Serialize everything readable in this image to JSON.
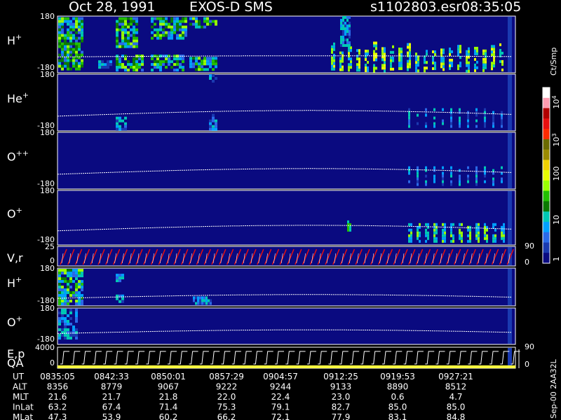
{
  "header": {
    "date": "Oct 28, 1991",
    "instrument": "EXOS-D SMS",
    "file": "s1102803.esr",
    "time": "08:35:05"
  },
  "colorbar": {
    "label": "Ct/Smp",
    "ticks": [
      {
        "text": "10",
        "exp": "4"
      },
      {
        "text": "10",
        "exp": "3"
      },
      {
        "text": "100",
        "exp": ""
      },
      {
        "text": "10",
        "exp": ""
      },
      {
        "text": "1",
        "exp": ""
      }
    ],
    "colors": [
      "#ffffff",
      "#ff9bb0",
      "#b00000",
      "#e81010",
      "#ff2a00",
      "#6b6b00",
      "#9a8a00",
      "#f0d000",
      "#e8ff00",
      "#9aff00",
      "#22c000",
      "#0a7a00",
      "#00c8b4",
      "#00a0ff",
      "#2a6ae8",
      "#1a3ab0",
      "#0a0a80"
    ]
  },
  "panels": [
    {
      "id": "h-plus",
      "label": "H",
      "sup": "+",
      "ymax": "180",
      "ymin": "-180"
    },
    {
      "id": "he-plus",
      "label": "He",
      "sup": "+",
      "ymax": "180",
      "ymin": "-180"
    },
    {
      "id": "o-plusplus",
      "label": "O",
      "sup": "++",
      "ymax": "180",
      "ymin": "-180"
    },
    {
      "id": "o-plus",
      "label": "O",
      "sup": "+",
      "ymax": "180",
      "ymin": "-180"
    },
    {
      "id": "vr",
      "label": "V,r",
      "sup": "",
      "ymax": "25",
      "ymin": "0",
      "right_top": "90",
      "right_bottom": "0"
    },
    {
      "id": "h-plus-2",
      "label": "H",
      "sup": "+",
      "ymax": "180",
      "ymin": "-180"
    },
    {
      "id": "o-plus-2",
      "label": "O",
      "sup": "+",
      "ymax": "180",
      "ymin": "-180"
    },
    {
      "id": "ep-qa",
      "label": "E,p",
      "label2": "QA",
      "sup": "",
      "ymax": "4000",
      "ymin": "0",
      "right_top": "90",
      "right_bottom": "0"
    }
  ],
  "table": {
    "rows": [
      {
        "name": "UT",
        "values": [
          "0835:05",
          "0842:33",
          "0850:01",
          "0857:29",
          "0904:57",
          "0912:25",
          "0919:53",
          "0927:21"
        ]
      },
      {
        "name": "ALT",
        "values": [
          "8356",
          "8779",
          "9067",
          "9222",
          "9244",
          "9133",
          "8890",
          "8512"
        ]
      },
      {
        "name": "MLT",
        "values": [
          "21.6",
          "21.7",
          "21.8",
          "22.0",
          "22.4",
          "23.0",
          "0.6",
          "4.7"
        ]
      },
      {
        "name": "InLat",
        "values": [
          "63.2",
          "67.4",
          "71.4",
          "75.3",
          "79.1",
          "82.7",
          "85.0",
          "85.0"
        ]
      },
      {
        "name": "MLat",
        "values": [
          "47.3",
          "53.9",
          "60.2",
          "66.2",
          "72.1",
          "77.9",
          "83.1",
          "84.8"
        ]
      }
    ]
  },
  "side_label": "Sep-00 2AA32L",
  "chart_data": {
    "type": "heatmap",
    "title": "Oct 28, 1991   EXOS-D SMS",
    "x": [
      "0835:05",
      "0842:33",
      "0850:01",
      "0857:29",
      "0904:57",
      "0912:25",
      "0919:53",
      "0927:21"
    ],
    "series": [
      {
        "name": "H+",
        "ylim": [
          -180,
          180
        ]
      },
      {
        "name": "He+",
        "ylim": [
          -180,
          180
        ]
      },
      {
        "name": "O++",
        "ylim": [
          -180,
          180
        ]
      },
      {
        "name": "O+",
        "ylim": [
          -180,
          180
        ]
      },
      {
        "name": "V,r",
        "ylim": [
          0,
          25
        ]
      },
      {
        "name": "H+",
        "ylim": [
          -180,
          180
        ]
      },
      {
        "name": "O+",
        "ylim": [
          -180,
          180
        ]
      },
      {
        "name": "E,p",
        "ylim": [
          0,
          4000
        ]
      }
    ],
    "colorscale": {
      "label": "Ct/Smp",
      "ticks": [
        "1",
        "10",
        "100",
        "10^3",
        "10^4"
      ]
    }
  }
}
